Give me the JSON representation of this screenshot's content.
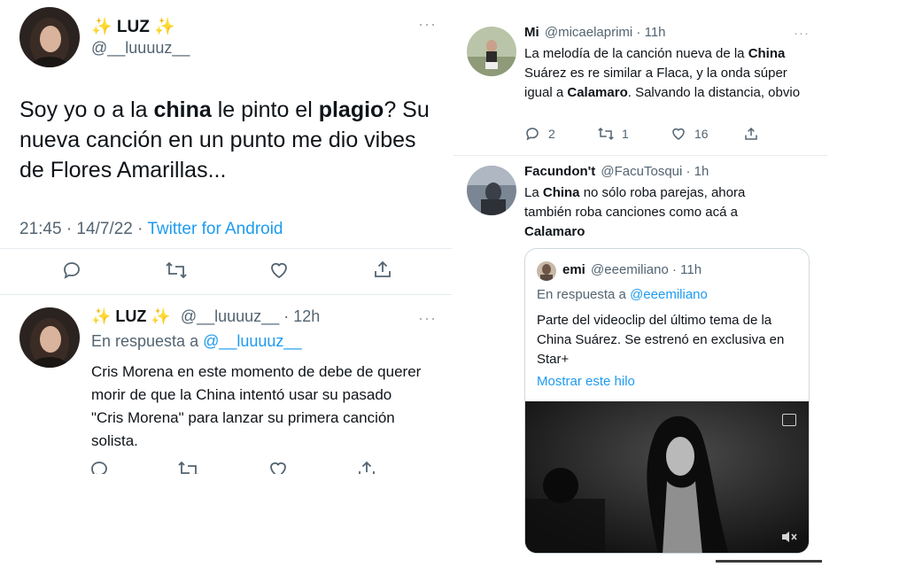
{
  "main_tweet": {
    "name": "✨ LUZ ✨",
    "handle": "@__luuuuz__",
    "text": [
      {
        "t": "Soy yo o a la ",
        "b": false
      },
      {
        "t": "china",
        "b": true
      },
      {
        "t": " le pinto el ",
        "b": false
      },
      {
        "t": "plagio",
        "b": true
      },
      {
        "t": "? Su nueva canción en un punto me dio vibes de Flores Amarillas...",
        "b": false
      }
    ],
    "timestamp": "21:45 · 14/7/22 · ",
    "source": "Twitter for Android"
  },
  "reply_tweet": {
    "name": "✨ LUZ ✨",
    "handle": "@__luuuuz__ · 12h",
    "in_reply_prefix": "En respuesta a ",
    "in_reply_handle": "@__luuuuz__",
    "text": "Cris Morena en este momento de debe de querer morir de que la China intentó usar su pasado \"Cris Morena\" para lanzar su primera canción solista."
  },
  "right_tweet_1": {
    "name": "Mi",
    "handle": "@micaelaprimi · 11h",
    "text": [
      {
        "t": "La melodía de la canción nueva de la ",
        "b": false
      },
      {
        "t": "China",
        "b": true
      },
      {
        "t": " Suárez es re similar a Flaca, y la onda súper igual a ",
        "b": false
      },
      {
        "t": "Calamaro",
        "b": true
      },
      {
        "t": ". Salvando la distancia, obvio",
        "b": false
      }
    ],
    "replies": "2",
    "retweets": "1",
    "likes": "16"
  },
  "right_tweet_2": {
    "name": "Facundon't",
    "handle": "@FacuTosqui · 1h",
    "text": [
      {
        "t": "La ",
        "b": false
      },
      {
        "t": "China",
        "b": true
      },
      {
        "t": " no sólo roba parejas, ahora también roba canciones como acá a ",
        "b": false
      },
      {
        "t": "Calamaro",
        "b": true
      }
    ]
  },
  "quoted_tweet": {
    "name": "emi",
    "handle": "@eeemiliano · 11h",
    "in_reply_prefix": "En respuesta a ",
    "in_reply_handle": "@eeemiliano",
    "text": "Parte del videoclip del último tema de la China Suárez. Se estrenó en exclusiva en Star+",
    "show_thread": "Mostrar este hilo"
  },
  "icons": [
    "reply-icon",
    "retweet-icon",
    "like-icon",
    "share-icon",
    "more-icon",
    "captions-icon",
    "mute-icon"
  ],
  "colors": {
    "link": "#1d9bf0",
    "muted": "#536471",
    "divider": "#e6ecf0"
  }
}
